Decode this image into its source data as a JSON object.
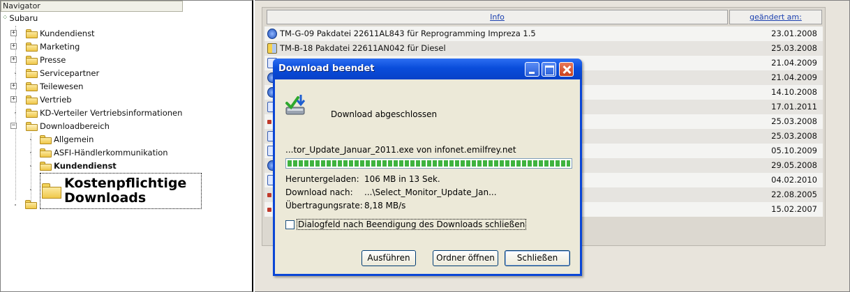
{
  "navigator": {
    "title": "Navigator",
    "root": "Subaru",
    "items": [
      {
        "label": "Kundendienst"
      },
      {
        "label": "Marketing"
      },
      {
        "label": "Presse"
      },
      {
        "label": "Servicepartner"
      },
      {
        "label": "Teilewesen"
      },
      {
        "label": "Vertrieb"
      },
      {
        "label": "KD-Verteiler Vertriebsinformationen"
      },
      {
        "label": "Downloadbereich"
      }
    ],
    "sub_items": [
      {
        "label": "Allgemein"
      },
      {
        "label": "ASFI-Händlerkommunikation"
      },
      {
        "label": "Kundendienst"
      }
    ],
    "selected_line1": "Kostenpflichtige",
    "selected_line2": "Downloads"
  },
  "table": {
    "col_info": "Info",
    "col_changed": "geändert am:",
    "rows": [
      {
        "text": "TM-G-09 Pakdatei 22611AL843 für Reprogramming Impreza 1.5",
        "date": "23.01.2008",
        "icon": "ie-icon"
      },
      {
        "text": "TM-B-18 Pakdatei 22611AN042 für Diesel",
        "date": "25.03.2008",
        "icon": "archive-icon"
      },
      {
        "text": "",
        "date": "21.04.2009",
        "icon": "file-icon"
      },
      {
        "text": "",
        "date": "21.04.2009",
        "icon": "ie-icon"
      },
      {
        "text": "",
        "date": "14.10.2008",
        "icon": "ie-icon"
      },
      {
        "text": "",
        "date": "17.01.2011",
        "icon": "doc-icon"
      },
      {
        "text": "",
        "date": "25.03.2008",
        "icon": "red-icon"
      },
      {
        "text": "",
        "date": "25.03.2008",
        "icon": "doc-icon"
      },
      {
        "text": "",
        "date": "05.10.2009",
        "icon": "doc-icon"
      },
      {
        "text": "",
        "date": "29.05.2008",
        "icon": "ie-icon"
      },
      {
        "text": "",
        "date": "04.02.2010",
        "icon": "doc-icon"
      },
      {
        "text": "",
        "date": "22.08.2005",
        "icon": "red-icon"
      },
      {
        "text": "",
        "date": "15.02.2007",
        "icon": "red-icon"
      }
    ]
  },
  "dialog": {
    "title": "Download beendet",
    "message": "Download abgeschlossen",
    "filename": "...tor_Update_Januar_2011.exe von infonet.emilfrey.net",
    "progress_percent": 100,
    "downloaded_label": "Heruntergeladen:",
    "downloaded_value": "106 MB in 13 Sek.",
    "target_label": "Download nach:",
    "target_value": "...\\Select_Monitor_Update_Jan...",
    "rate_label": "Übertragungsrate:",
    "rate_value": "8,18 MB/s",
    "checkbox_label": "Dialogfeld nach Beendigung des Downloads schließen",
    "checkbox_checked": false,
    "run_button": "Ausführen",
    "open_folder_button": "Ordner öffnen",
    "close_button": "Schließen"
  }
}
